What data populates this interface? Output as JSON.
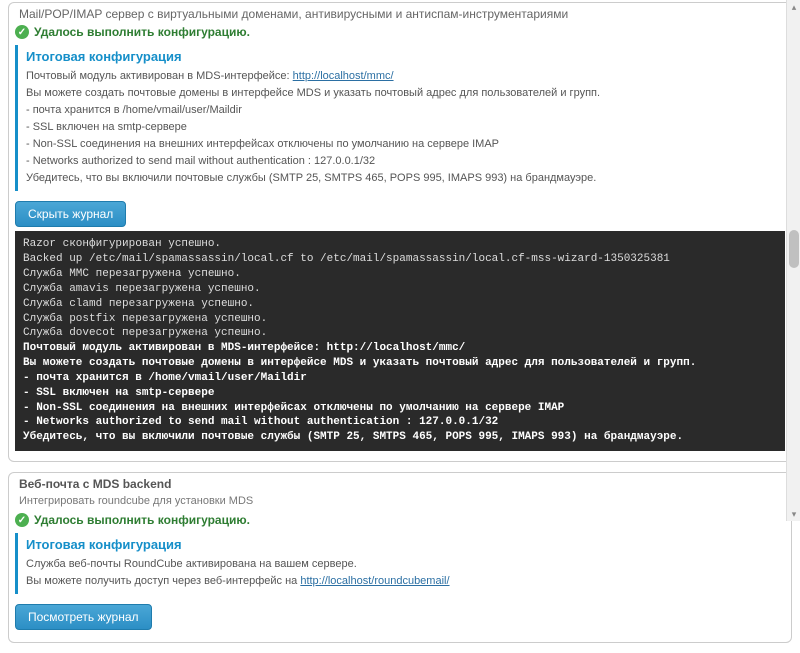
{
  "panel1": {
    "title": "Mail/POP/IMAP сервер с виртуальными доменами, антивирусными и антиспам-инструментариями",
    "success": "Удалось выполнить конфигурацию.",
    "config_head": "Итоговая конфигурация",
    "line_activated_pre": "Почтовый модуль активирован в MDS-интерфейсе: ",
    "link_mmc": "http://localhost/mmc/",
    "line_domains": "Вы можете создать почтовые домены в интерфейсе MDS и указать почтовый адрес для пользователей и групп.",
    "line_maildir": "- почта хранится в /home/vmail/user/Maildir",
    "line_ssl": "- SSL включен на smtp-сервере",
    "line_nonssl": "- Non-SSL соединения на внешних интерфейсах отключены по умолчанию на сервере IMAP",
    "line_networks": "- Networks authorized to send mail without authentication : 127.0.0.1/32",
    "line_firewall": "Убедитесь, что вы включили почтовые службы (SMTP 25, SMTPS 465, POPS 995, IMAPS 993) на брандмауэре.",
    "btn_hide": "Скрыть журнал",
    "log": {
      "l1": "Razor сконфигурирован успешно.",
      "l2": "Backed up /etc/mail/spamassassin/local.cf to /etc/mail/spamassassin/local.cf-mss-wizard-1350325381",
      "l3": "Служба MMC перезагружена успешно.",
      "l4": "Служба amavis перезагружена успешно.",
      "l5": "Служба clamd перезагружена успешно.",
      "l6": "Служба postfix перезагружена успешно.",
      "l7": "Служба dovecot перезагружена успешно.",
      "b1": "Почтовый модуль активирован в MDS-интерфейсе: http://localhost/mmc/",
      "b2": "Вы можете создать почтовые домены в интерфейсе MDS и указать почтовый адрес для пользователей и групп.",
      "b3": "- почта хранится в /home/vmail/user/Maildir",
      "b4": "- SSL включен на smtp-сервере",
      "b5": "- Non-SSL соединения на внешних интерфейсах отключены по умолчанию на сервере IMAP",
      "b6": "- Networks authorized to send mail without authentication : 127.0.0.1/32",
      "b7": "Убедитесь, что вы включили почтовые службы (SMTP 25, SMTPS 465, POPS 995, IMAPS 993) на брандмауэре."
    }
  },
  "panel2": {
    "title": "Веб-почта с MDS backend",
    "subtitle": "Интегрировать roundcube для установки MDS",
    "success": "Удалось выполнить конфигурацию.",
    "config_head": "Итоговая конфигурация",
    "line_activated": "Служба веб-почты RoundCube активирована на вашем сервере.",
    "line_access_pre": "Вы можете получить доступ через веб-интерфейс на ",
    "link_roundcube": "http://localhost/roundcubemail/",
    "btn_show": "Посмотреть журнал"
  }
}
